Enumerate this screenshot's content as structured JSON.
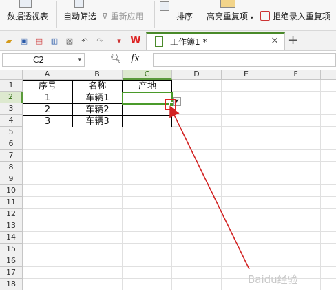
{
  "ribbon": {
    "items": [
      {
        "label": "数据透视表"
      },
      {
        "label": "自动筛选"
      },
      {
        "label": "重新应用"
      },
      {
        "label": "排序"
      },
      {
        "label": "高亮重复项"
      },
      {
        "label": "拒绝录入重复项"
      }
    ]
  },
  "quickbar": {
    "tab_label": "工作簿1 *",
    "close": "×",
    "new_tab": "+"
  },
  "formula": {
    "cell_ref": "C2",
    "fx": "fx",
    "value": ""
  },
  "sheet": {
    "columns": [
      "A",
      "B",
      "C",
      "D",
      "E",
      "F"
    ],
    "rows": [
      "1",
      "2",
      "3",
      "4",
      "5",
      "6",
      "7",
      "8",
      "9",
      "10",
      "11",
      "12",
      "13",
      "14",
      "15",
      "16",
      "17",
      "18"
    ],
    "selected_column": "C",
    "selected_row": "2",
    "cells": {
      "A1": "序号",
      "B1": "名称",
      "C1": "产地",
      "A2": "1",
      "B2": "车辆1",
      "C2": "",
      "A3": "2",
      "B3": "车辆2",
      "C3": "",
      "A4": "3",
      "B4": "车辆3",
      "C4": ""
    }
  },
  "watermark": "Baidu经验",
  "colors": {
    "selection": "#4a9a2a",
    "annotation": "#d22222"
  }
}
